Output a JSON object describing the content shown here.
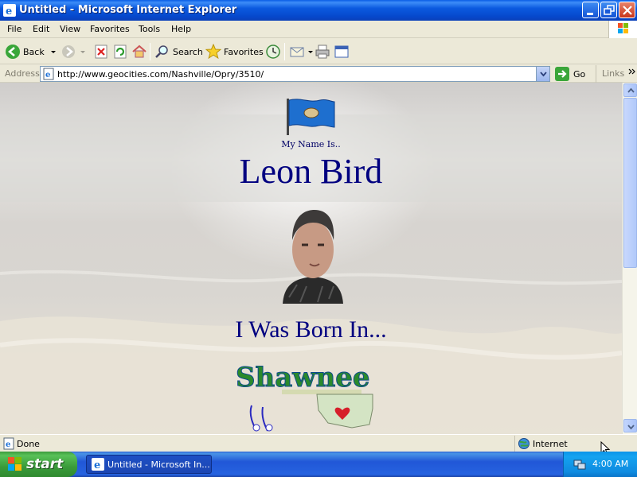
{
  "window": {
    "title": "Untitled - Microsoft Internet Explorer"
  },
  "menubar": {
    "items": [
      "File",
      "Edit",
      "View",
      "Favorites",
      "Tools",
      "Help"
    ]
  },
  "toolbar": {
    "back_label": "Back",
    "search_label": "Search",
    "favorites_label": "Favorites"
  },
  "addressbar": {
    "label": "Address",
    "url": "http://www.geocities.com/Nashville/Opry/3510/",
    "go_label": "Go",
    "links_label": "Links"
  },
  "page": {
    "intro": "My Name Is..",
    "name": "Leon Bird",
    "born_heading": "I Was Born In...",
    "town_logo_text": "Shawnee"
  },
  "statusbar": {
    "status": "Done",
    "zone": "Internet"
  },
  "taskbar": {
    "start_label": "start",
    "task_label": "Untitled - Microsoft In...",
    "clock": "4:00 AM"
  },
  "colors": {
    "heading": "#000080",
    "title_bar": "#0A5EE6",
    "taskbar": "#2157d7",
    "start_button": "#3a9b3a"
  }
}
